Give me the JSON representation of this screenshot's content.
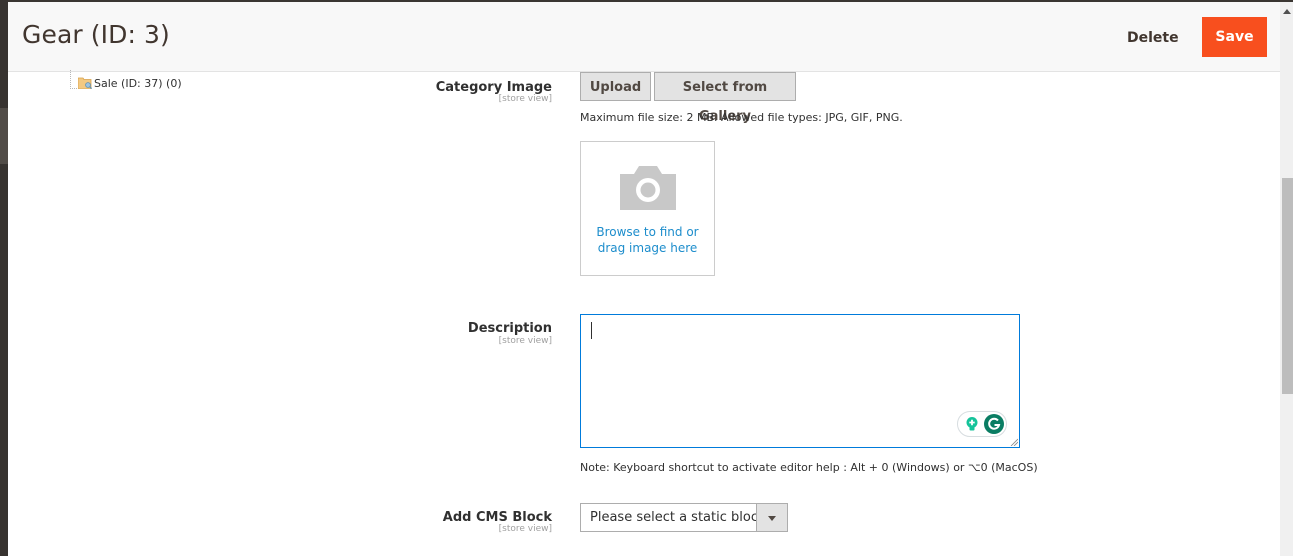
{
  "header": {
    "title": "Gear (ID: 3)",
    "delete_label": "Delete",
    "save_label": "Save"
  },
  "colors": {
    "save_button": "#f84f1e",
    "link": "#1d8dcc",
    "focus_border": "#007bdb"
  },
  "category_tree": {
    "visible_node": {
      "label": "Sale (ID: 37) (0)",
      "icon": "folder-icon"
    }
  },
  "form": {
    "category_image": {
      "label": "Category Image",
      "scope": "[store view]",
      "upload_label": "Upload",
      "gallery_label": "Select from Gallery",
      "note": "Maximum file size: 2 MB. Allowed file types: JPG, GIF, PNG.",
      "dropzone_icon": "camera-icon",
      "dropzone_text_line1": "Browse to find or",
      "dropzone_text_line2": "drag image here"
    },
    "description": {
      "label": "Description",
      "scope": "[store view]",
      "value": "",
      "note": "Note: Keyboard shortcut to activate editor help : Alt + 0 (Windows) or ⌥0 (MacOS)"
    },
    "cms_block": {
      "label": "Add CMS Block",
      "scope": "[store view]",
      "selected": "Please select a static block."
    }
  }
}
